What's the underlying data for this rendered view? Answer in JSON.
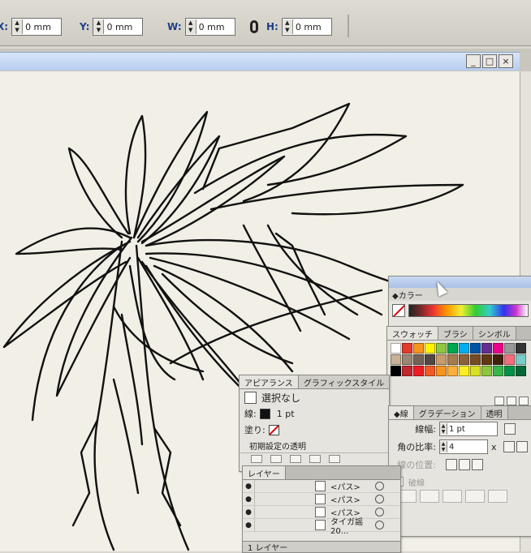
{
  "control_bar": {
    "x": {
      "label": "X:",
      "value": "0 mm"
    },
    "y": {
      "label": "Y:",
      "value": "0 mm"
    },
    "w": {
      "label": "W:",
      "value": "0 mm"
    },
    "h": {
      "label": "H:",
      "value": "0 mm"
    }
  },
  "window": {
    "buttons": {
      "minimize": "_",
      "maximize": "□",
      "close": "×"
    }
  },
  "color_panel": {
    "tab": "◆カラー"
  },
  "swatch_panel": {
    "tabs": [
      "スウォッチ",
      "ブラシ",
      "シンボル"
    ],
    "colors": [
      "#ffffff",
      "#e23b2e",
      "#f7941d",
      "#fff200",
      "#8dc63f",
      "#00a651",
      "#00aeef",
      "#0054a6",
      "#662d91",
      "#ec008c",
      "#999999",
      "#333333",
      "#c7b299",
      "#998675",
      "#736357",
      "#534741",
      "#c69c6d",
      "#a67c52",
      "#8c6239",
      "#754c24",
      "#603913",
      "#42210b",
      "#f26d7d",
      "#7accc8",
      "#000000",
      "#c1272d",
      "#ed1c24",
      "#f15a24",
      "#f7931e",
      "#fbb03b",
      "#fcee21",
      "#d9e021",
      "#8cc63f",
      "#39b54a",
      "#009245",
      "#006837"
    ]
  },
  "appearance_panel": {
    "tabs": [
      "アピアランス",
      "グラフィックスタイル"
    ],
    "selection": "選択なし",
    "stroke_label": "線:",
    "stroke_value": "1 pt",
    "fill_label": "塗り:",
    "default_opacity": "初期設定の透明"
  },
  "stroke_panel": {
    "tabs": [
      "◆線",
      "グラデーション",
      "透明"
    ],
    "weight_label": "線幅:",
    "weight_value": "1 pt",
    "miter_label": "角の比率:",
    "miter_value": "4",
    "miter_unit": "x",
    "align_label": "線の位置:",
    "dashed_label": "破線"
  },
  "layers_panel": {
    "tab": "レイヤー",
    "rows": [
      {
        "name": "<パス>"
      },
      {
        "name": "<パス>"
      },
      {
        "name": "<パス>"
      },
      {
        "name": "タイガ謡20..."
      }
    ],
    "footer": "1 レイヤー"
  }
}
